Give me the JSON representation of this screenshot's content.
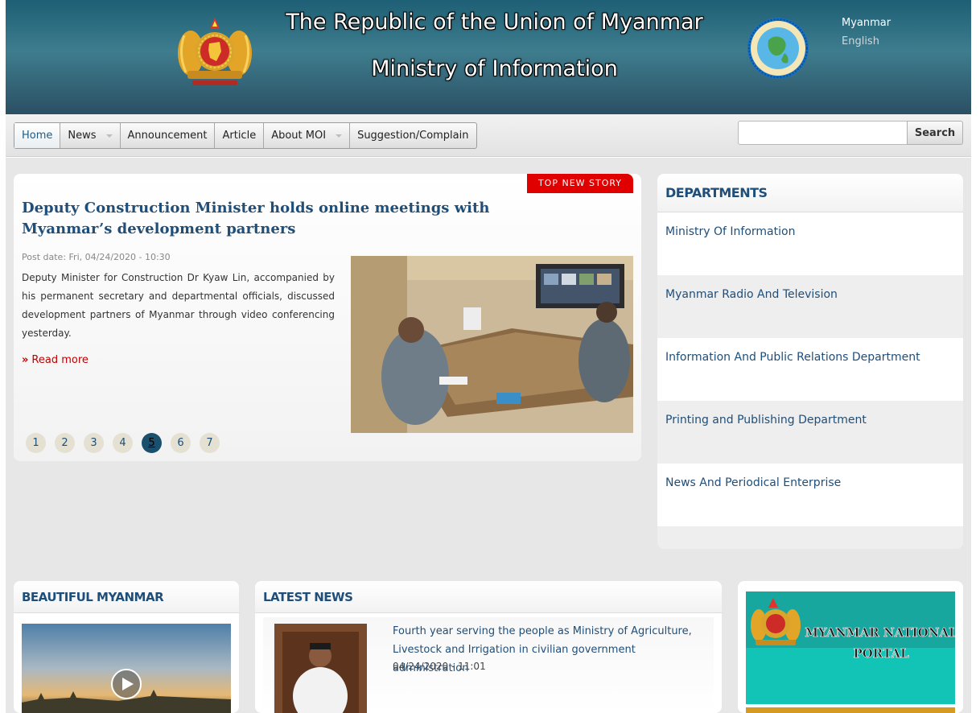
{
  "header": {
    "title_line1": "The Republic of the Union of Myanmar",
    "title_line2": "Ministry of Information",
    "lang_myanmar": "Myanmar",
    "lang_english": "English"
  },
  "nav": {
    "items": [
      "Home",
      "News",
      "Announcement",
      "Article",
      "About MOI",
      "Suggestion/Complain"
    ],
    "search_value": "",
    "search_button": "Search"
  },
  "top_story": {
    "badge": "TOP NEW STORY",
    "title": "Deputy Construction Minister holds online meetings with Myanmar’s development partners",
    "post_date": "Post date: Fri, 04/24/2020 - 10:30",
    "summary": "Deputy Minister for Construction Dr Kyaw Lin, accompanied by his permanent secretary and departmental officials, discussed development partners of Myanmar through video conferencing yesterday.",
    "read_more": "Read more",
    "pages": [
      "1",
      "2",
      "3",
      "4",
      "5",
      "6",
      "7"
    ],
    "current_page": "5"
  },
  "departments": {
    "heading": "DEPARTMENTS",
    "items": [
      "Ministry Of Information",
      "Myanmar Radio And Television",
      "Information And Public Relations Department",
      "Printing and Publishing Department",
      "News And Periodical Enterprise"
    ]
  },
  "beautiful": {
    "heading": "BEAUTIFUL MYANMAR"
  },
  "latest_news": {
    "heading": "LATEST NEWS",
    "item_title": "Fourth year serving the people as Ministry of Agriculture, Livestock and Irrigation in civilian government administration",
    "item_date": "04/24/2020 - 11:01"
  },
  "portal": {
    "text_line1": "MYANMAR NATIONAL",
    "text_line2": "PORTAL"
  },
  "colors": {
    "header_teal": "#2b6b80",
    "link_blue": "#1f4e79",
    "badge_red": "#e00000",
    "readmore_red": "#c00000",
    "portal_teal": "#12c4b6"
  },
  "icons": [
    "state-emblem-icon",
    "moi-seal-icon",
    "caret-down-icon",
    "read-more-chevron-icon",
    "play-icon"
  ]
}
